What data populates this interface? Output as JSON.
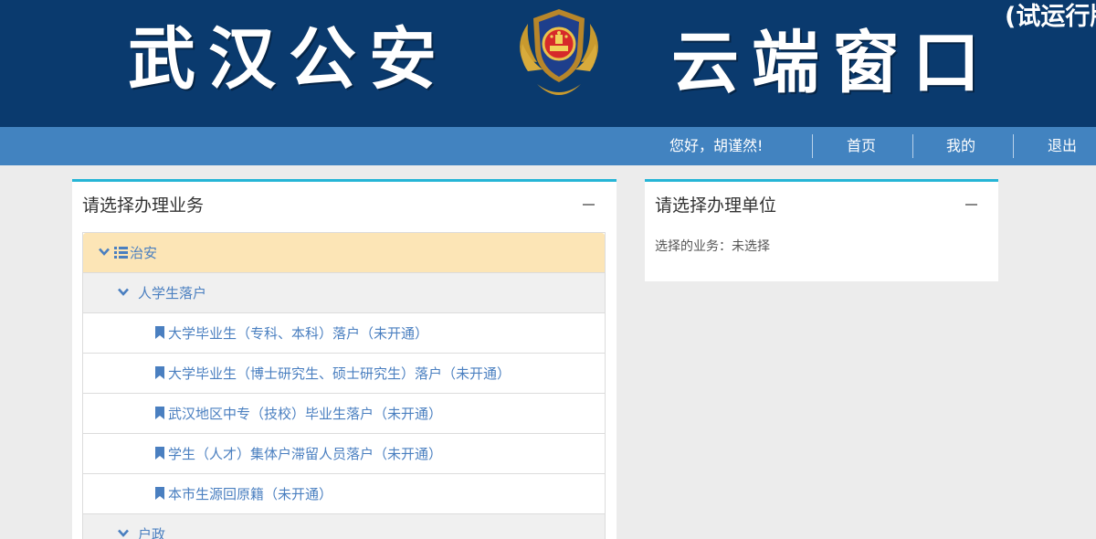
{
  "banner": {
    "title_left": "武汉公安",
    "title_right": "云端窗口",
    "subtitle": "(试运行版"
  },
  "nav": {
    "greeting": "您好，胡谨然!",
    "home": "首页",
    "mine": "我的",
    "logout": "退出"
  },
  "left_panel": {
    "title": "请选择办理业务",
    "tree": {
      "category": "治安",
      "group1": {
        "label": "人学生落户",
        "items": [
          "大学毕业生（专科、本科）落户（未开通）",
          "大学毕业生（博士研究生、硕士研究生）落户（未开通）",
          "武汉地区中专（技校）毕业生落户（未开通）",
          "学生（人才）集体户滞留人员落户（未开通）",
          "本市生源回原籍（未开通）"
        ]
      },
      "group2": {
        "label": "户政"
      }
    }
  },
  "right_panel": {
    "title": "请选择办理单位",
    "selected_label": "选择的业务：",
    "selected_value": "未选择"
  },
  "colors": {
    "banner_bg": "#0a3a6e",
    "navbar_bg": "#4283c0",
    "panel_accent": "#26b5d6",
    "link_blue": "#4a7fc0",
    "category_bg": "#fce5b6"
  }
}
